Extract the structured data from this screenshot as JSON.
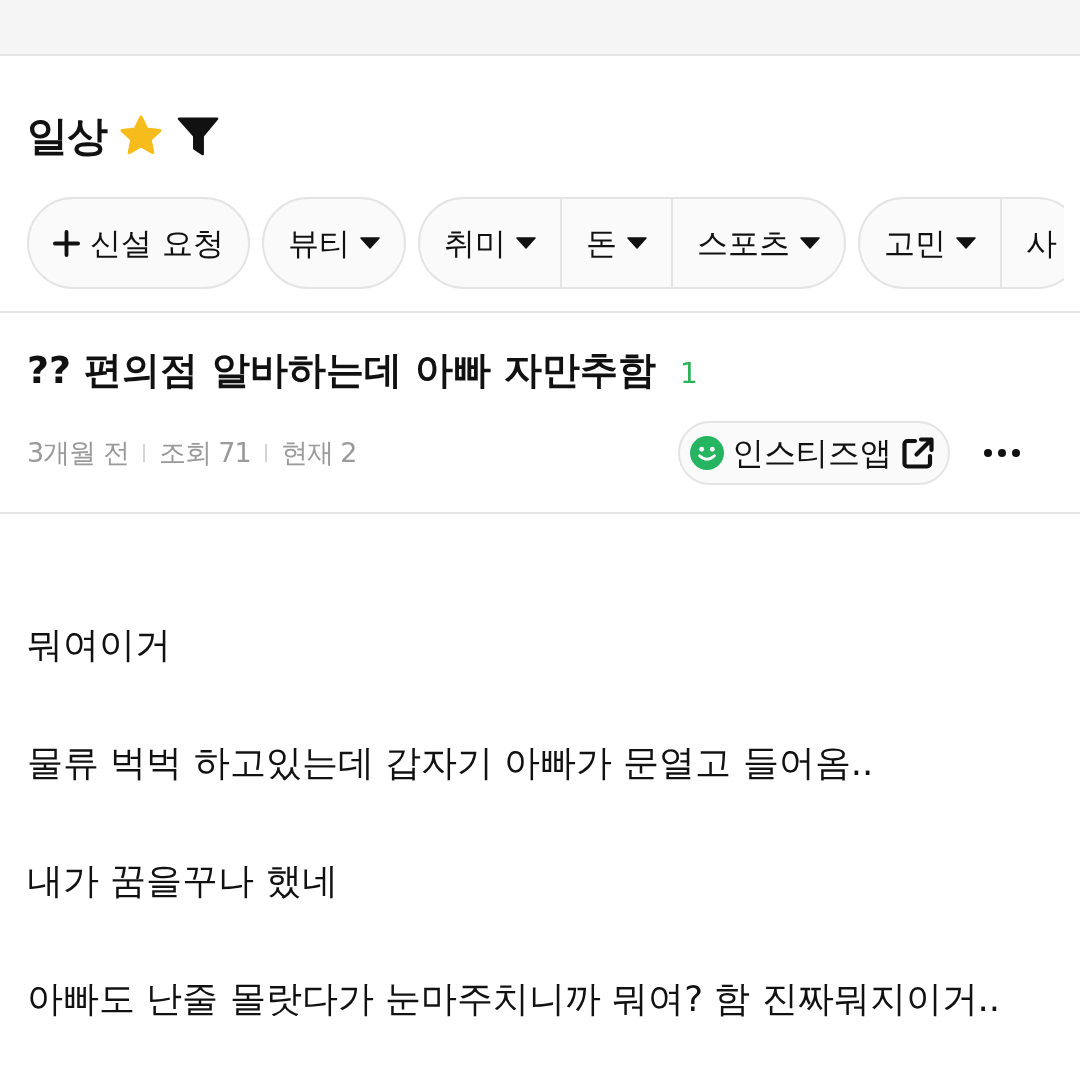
{
  "board": {
    "title": "일상",
    "favorite": true
  },
  "chip_groups": [
    {
      "items": [
        {
          "label": "신설 요청",
          "kind": "add",
          "has_menu": false
        }
      ]
    },
    {
      "items": [
        {
          "label": "뷰티",
          "kind": "category",
          "has_menu": true
        }
      ]
    },
    {
      "items": [
        {
          "label": "취미",
          "kind": "category",
          "has_menu": true
        },
        {
          "label": "돈",
          "kind": "category",
          "has_menu": true
        },
        {
          "label": "스포츠",
          "kind": "category",
          "has_menu": true
        }
      ]
    },
    {
      "items": [
        {
          "label": "고민",
          "kind": "category",
          "has_menu": true
        },
        {
          "label": "사",
          "kind": "category",
          "has_menu": false
        }
      ]
    }
  ],
  "post": {
    "title": "?? 편의점 알바하는데 아빠 자만추함",
    "comment_count": "1",
    "meta": [
      "3개월 전",
      "조회 71",
      "현재 2"
    ],
    "app_button": "인스티즈앱"
  },
  "body": [
    "뭐여이거",
    "물류 벅벅 하고있는데 갑자기 아빠가 문열고 들어옴..",
    "내가 꿈을꾸나 했네",
    "아빠도 난줄 몰랏다가 눈마주치니까 뭐여? 함 진짜뭐지이거.."
  ]
}
